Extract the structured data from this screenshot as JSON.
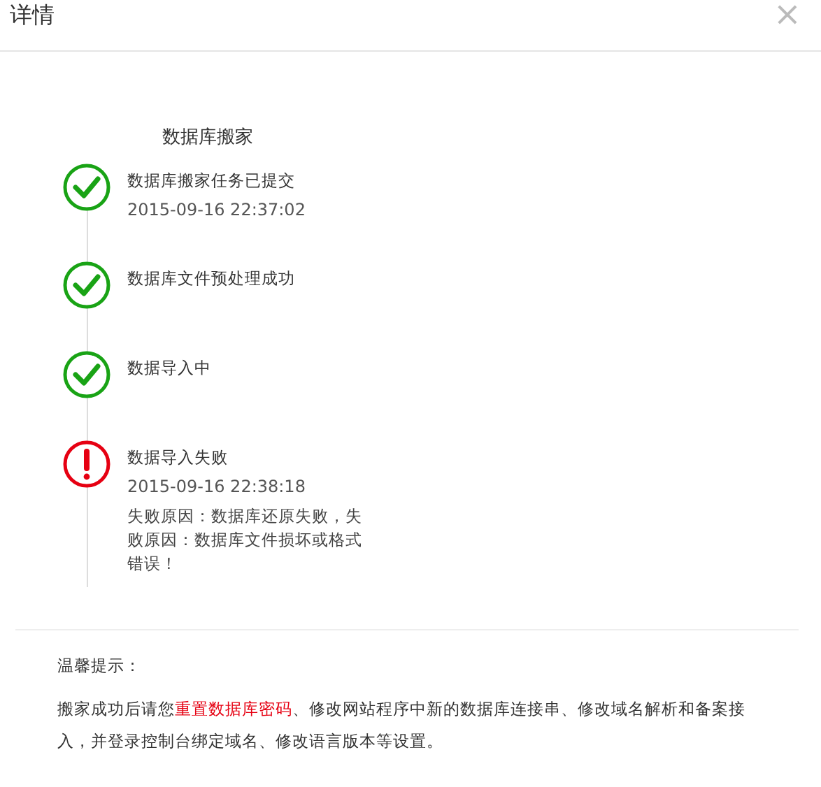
{
  "dialog": {
    "title": "详情",
    "close": "×"
  },
  "section_title": "数据库搬家",
  "steps": [
    {
      "kind": "success",
      "title": "数据库搬家任务已提交",
      "time": "2015-09-16 22:37:02"
    },
    {
      "kind": "success",
      "title": "数据库文件预处理成功"
    },
    {
      "kind": "success",
      "title": "数据导入中"
    },
    {
      "kind": "error",
      "title": "数据导入失败",
      "time": "2015-09-16 22:38:18",
      "reason": "失败原因：数据库还原失败，失败原因：数据库文件损坏或格式错误！"
    }
  ],
  "tips": {
    "heading": "温馨提示：",
    "before": "搬家成功后请您",
    "link": "重置数据库密码",
    "after": "、修改网站程序中新的数据库连接串、修改域名解析和备案接入，并登录控制台绑定域名、修改语言版本等设置。"
  }
}
